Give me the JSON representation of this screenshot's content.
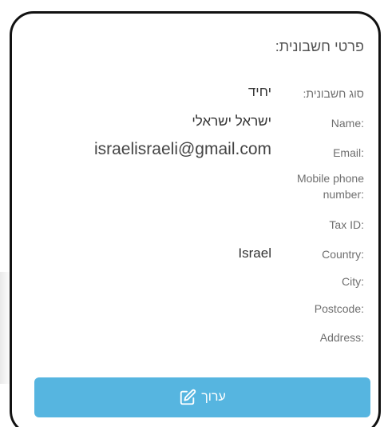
{
  "title": "פרטי חשבונית:",
  "fields": [
    {
      "label": "סוג חשבונית:",
      "value": "יחיד"
    },
    {
      "label": "Name:",
      "value": "ישראל ישראלי"
    },
    {
      "label": "Email:",
      "value": "israelisraeli@gmail.com"
    },
    {
      "label": "Mobile phone number:",
      "value": ""
    },
    {
      "label": "Tax ID:",
      "value": ""
    },
    {
      "label": "Country:",
      "value": "Israel"
    },
    {
      "label": "City:",
      "value": ""
    },
    {
      "label": "Postcode:",
      "value": ""
    },
    {
      "label": "Address:",
      "value": ""
    }
  ],
  "edit_button": {
    "label": "ערוך",
    "icon": "edit-icon"
  },
  "colors": {
    "button": "#56b5e0",
    "label": "#6f6f6f",
    "value": "#333333",
    "border": "#111111"
  }
}
